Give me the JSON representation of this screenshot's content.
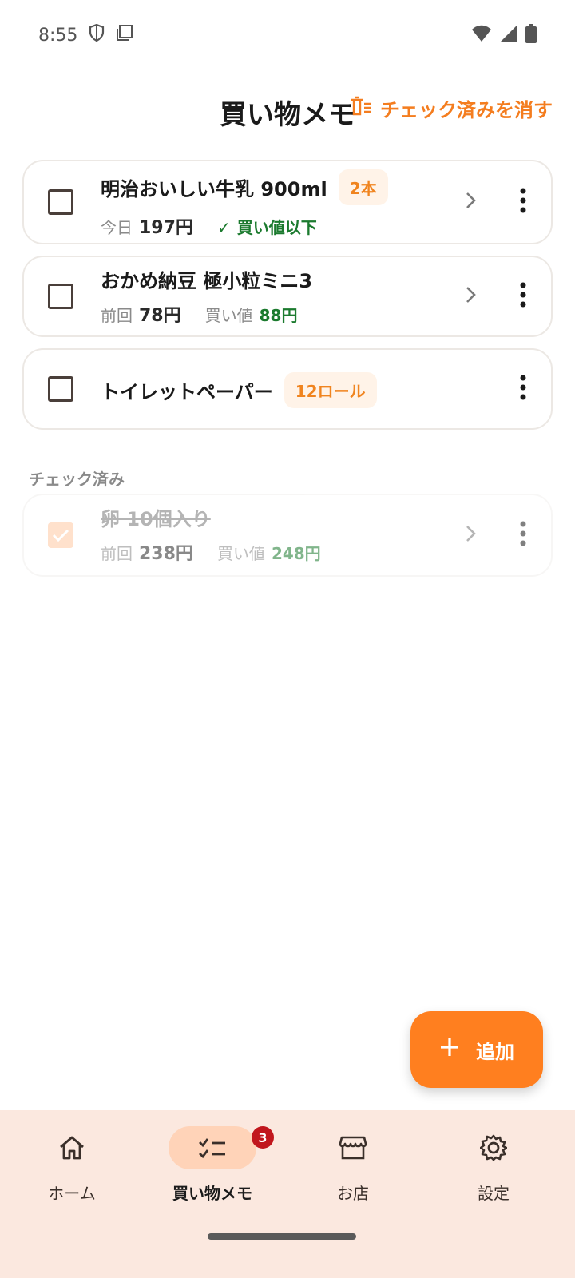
{
  "status": {
    "time": "8:55"
  },
  "header": {
    "title": "買い物メモ",
    "clear_checked": "チェック済みを消す"
  },
  "items": [
    {
      "title": "明治おいしい牛乳 900ml",
      "qty": "2本",
      "label": "今日",
      "price": "197円",
      "note": "買い値以下"
    },
    {
      "title": "おかめ納豆 極小粒ミニ3",
      "label": "前回",
      "price": "78円",
      "buy_label": "買い値",
      "buy_price": "88円"
    },
    {
      "title": "トイレットペーパー",
      "qty": "12ロール"
    }
  ],
  "checked_section": {
    "label": "チェック済み"
  },
  "checked_items": [
    {
      "title": "卵 10個入り",
      "label": "前回",
      "price": "238円",
      "buy_label": "買い値",
      "buy_price": "248円"
    }
  ],
  "fab": {
    "label": "追加"
  },
  "nav": {
    "home": "ホーム",
    "shopping": "買い物メモ",
    "shopping_badge": "3",
    "stores": "お店",
    "settings": "設定"
  },
  "colors": {
    "accent": "#ff7f1f",
    "good": "#1b7a2e",
    "nav_bg": "#fbe8df"
  }
}
